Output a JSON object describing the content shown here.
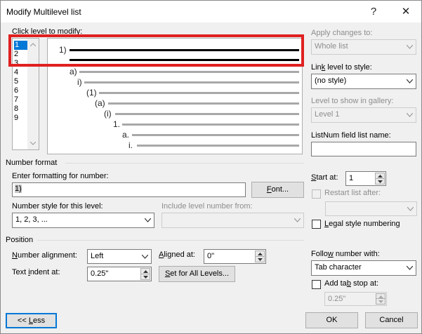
{
  "window": {
    "title": "Modify Multilevel list",
    "help_glyph": "?",
    "close_glyph": "✕"
  },
  "left": {
    "click_level_label": "Click level to modify:",
    "levels": [
      "1",
      "2",
      "3",
      "4",
      "5",
      "6",
      "7",
      "8",
      "9"
    ],
    "selected_level": "1"
  },
  "preview": {
    "labels": [
      "1)",
      "a)",
      "i)",
      "(1)",
      "(a)",
      "(i)",
      "1.",
      "a.",
      "i."
    ]
  },
  "right": {
    "apply_changes_label": "Apply changes to:",
    "apply_changes_value": "Whole list",
    "link_level_label": "Link level to style:",
    "link_level_value": "(no style)",
    "level_gallery_label": "Level to show in gallery:",
    "level_gallery_value": "Level 1",
    "listnum_label": "ListNum field list name:",
    "listnum_value": ""
  },
  "number_format": {
    "section_label": "Number format",
    "enter_formatting_label": "Enter formatting for number:",
    "formatting_value": "1)",
    "font_button": "Font...",
    "number_style_label": "Number style for this level:",
    "number_style_value": "1, 2, 3, ...",
    "include_level_label": "Include level number from:",
    "include_level_value": "",
    "start_at_label": "Start at:",
    "start_at_value": "1",
    "restart_list_label": "Restart list after:",
    "restart_list_value": "",
    "legal_style_label": "Legal style numbering"
  },
  "position": {
    "section_label": "Position",
    "number_alignment_label": "Number alignment:",
    "number_alignment_value": "Left",
    "aligned_at_label": "Aligned at:",
    "aligned_at_value": "0\"",
    "text_indent_label": "Text indent at:",
    "text_indent_value": "0.25\"",
    "set_all_levels_button": "Set for All Levels...",
    "follow_number_label": "Follow number with:",
    "follow_number_value": "Tab character",
    "add_tab_stop_label": "Add tab stop at:",
    "add_tab_stop_value": "0.25\""
  },
  "footer": {
    "less_button": "<< Less",
    "ok_button": "OK",
    "cancel_button": "Cancel"
  }
}
